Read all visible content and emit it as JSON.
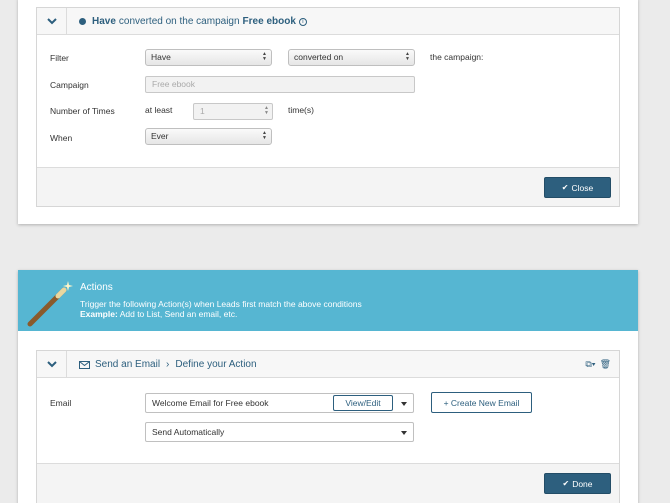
{
  "filter_panel": {
    "header": {
      "prefix": "Have",
      "middle": "converted on the campaign",
      "campaign": "Free ebook"
    },
    "filter_label": "Filter",
    "filter_value": "Have",
    "filter_action": "converted on",
    "the_campaign_label": "the campaign:",
    "campaign_label": "Campaign",
    "campaign_value": "Free ebook",
    "times_label": "Number of Times",
    "times_operator": "at least",
    "times_value": "1",
    "times_unit": "time(s)",
    "when_label": "When",
    "when_value": "Ever",
    "close_label": "Close"
  },
  "actions_banner": {
    "title": "Actions",
    "description": "Trigger the following Action(s) when Leads first match the above conditions",
    "example_label": "Example:",
    "example_text": "Add to List, Send an email, etc."
  },
  "action_panel": {
    "header": {
      "action": "Send an Email",
      "separator": "›",
      "step": "Define your Action"
    },
    "email_label": "Email",
    "email_value": "Welcome Email for Free ebook",
    "view_edit_label": "View/Edit",
    "create_email_label": "+ Create New Email",
    "send_value": "Send Automatically",
    "done_label": "Done"
  },
  "colors": {
    "accent": "#2d5f7e",
    "banner": "#56b6d2"
  },
  "icons": [
    "chevron-down-icon",
    "bullet-icon",
    "info-icon",
    "magic-wand-icon",
    "envelope-icon",
    "copy-icon",
    "trash-icon",
    "check-icon"
  ]
}
